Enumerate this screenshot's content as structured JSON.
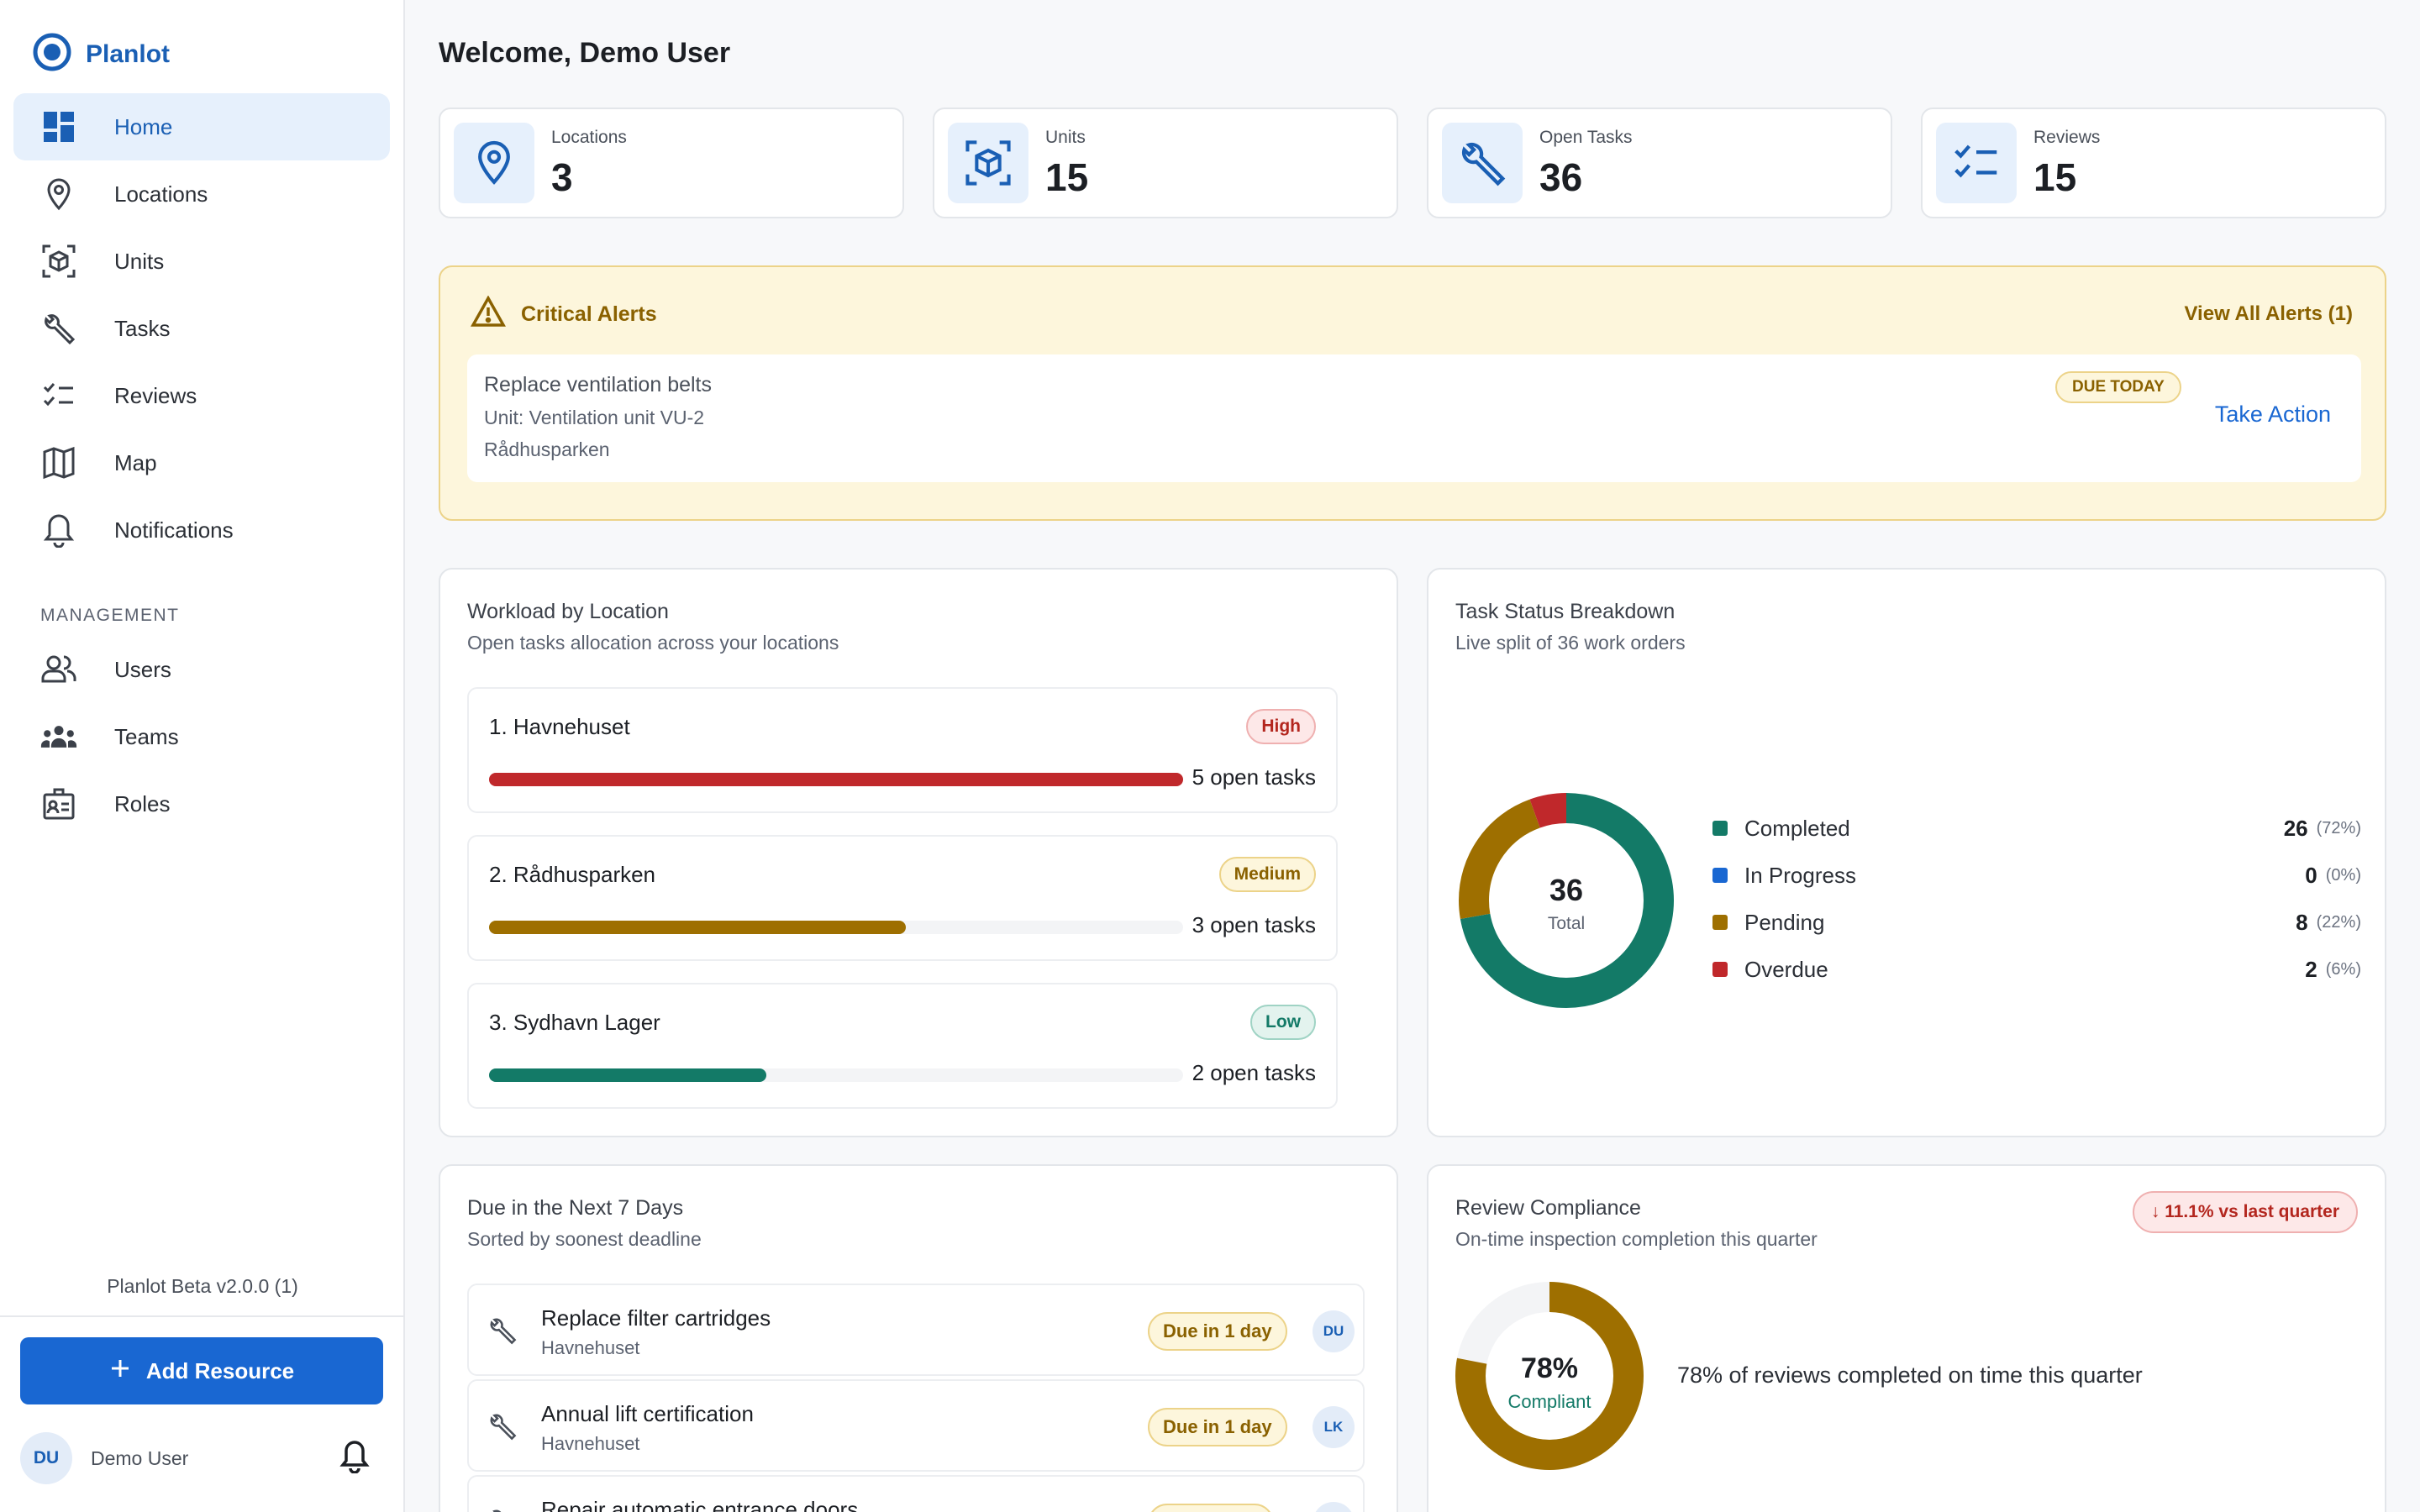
{
  "app": {
    "name": "Planlot",
    "version": "Planlot Beta v2.0.0 (1)"
  },
  "sidebar": {
    "items": [
      {
        "label": "Home",
        "icon": "dashboard-icon",
        "active": true
      },
      {
        "label": "Locations",
        "icon": "location-pin-icon"
      },
      {
        "label": "Units",
        "icon": "cube-icon"
      },
      {
        "label": "Tasks",
        "icon": "wrench-icon"
      },
      {
        "label": "Reviews",
        "icon": "checklist-icon"
      },
      {
        "label": "Map",
        "icon": "map-icon"
      },
      {
        "label": "Notifications",
        "icon": "bell-icon"
      }
    ],
    "management_label": "MANAGEMENT",
    "management": [
      {
        "label": "Users",
        "icon": "users-icon"
      },
      {
        "label": "Teams",
        "icon": "teams-icon"
      },
      {
        "label": "Roles",
        "icon": "badge-icon"
      }
    ],
    "add_button": "Add Resource",
    "user": {
      "initials": "DU",
      "name": "Demo User"
    }
  },
  "main": {
    "welcome": "Welcome, Demo User",
    "stats": [
      {
        "label": "Locations",
        "value": "3"
      },
      {
        "label": "Units",
        "value": "15"
      },
      {
        "label": "Open Tasks",
        "value": "36"
      },
      {
        "label": "Reviews",
        "value": "15"
      }
    ],
    "alerts": {
      "title": "Critical Alerts",
      "view_all": "View All Alerts (1)",
      "item": {
        "title": "Replace ventilation belts",
        "unit": "Unit: Ventilation unit VU-2",
        "location": "Rådhusparken",
        "badge": "DUE TODAY",
        "action": "Take Action"
      }
    },
    "workload": {
      "title": "Workload by Location",
      "subtitle": "Open tasks allocation across your locations",
      "items": [
        {
          "name": "1. Havnehuset",
          "badge": "High",
          "count": "5 open tasks",
          "fraction": 1.0
        },
        {
          "name": "2. Rådhusparken",
          "badge": "Medium",
          "count": "3 open tasks",
          "fraction": 0.6
        },
        {
          "name": "3. Sydhavn Lager",
          "badge": "Low",
          "count": "2 open tasks",
          "fraction": 0.4
        }
      ]
    },
    "status": {
      "title": "Task Status Breakdown",
      "subtitle": "Live split of 36 work orders",
      "total": "36",
      "total_label": "Total",
      "colors": {
        "Completed": "#137a67",
        "In Progress": "#1967d2",
        "Pending": "#9e6f00",
        "Overdue": "#c0282b"
      }
    },
    "due": {
      "title": "Due in the Next 7 Days",
      "subtitle": "Sorted by soonest deadline",
      "items": [
        {
          "name": "Replace filter cartridges",
          "location": "Havnehuset",
          "badge": "Due in 1 day",
          "assignee": "DU"
        },
        {
          "name": "Annual lift certification",
          "location": "Havnehuset",
          "badge": "Due in 1 day",
          "assignee": "LK"
        },
        {
          "name": "Repair automatic entrance doors",
          "location": "",
          "badge": "",
          "assignee": ""
        }
      ]
    },
    "compliance": {
      "title": "Review Compliance",
      "subtitle": "On-time inspection completion this quarter",
      "badge": "↓ 11.1% vs last quarter",
      "percent": "78%",
      "percent_value": 78,
      "label": "Compliant",
      "text": "78% of reviews completed on time this quarter"
    }
  },
  "chart_data": {
    "type": "pie",
    "categories": [
      "Completed",
      "In Progress",
      "Pending",
      "Overdue"
    ],
    "values": [
      26,
      0,
      8,
      2
    ],
    "percent_labels": [
      "(72%)",
      "(0%)",
      "(22%)",
      "(6%)"
    ]
  }
}
